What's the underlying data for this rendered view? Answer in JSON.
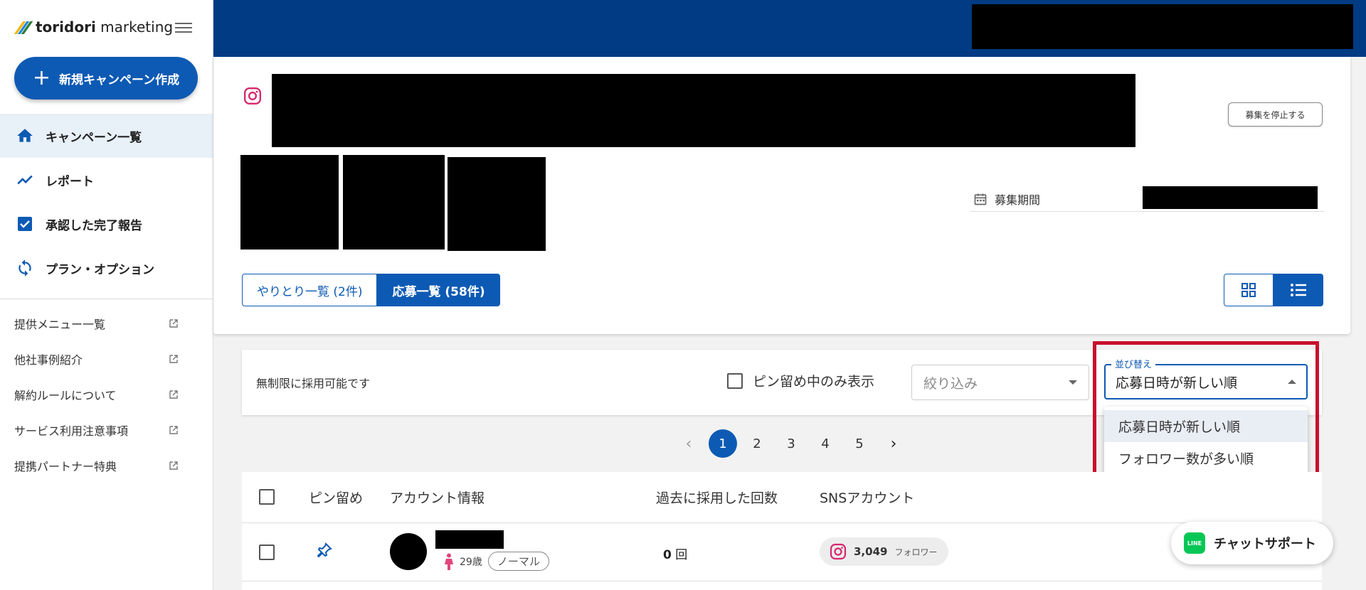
{
  "app": {
    "brand_bold": "toridori",
    "brand_rest": " marketing"
  },
  "sidebar": {
    "new_campaign_label": "新規キャンペーン作成",
    "nav": [
      {
        "label": "キャンペーン一覧",
        "icon": "home-icon"
      },
      {
        "label": "レポート",
        "icon": "trend-icon"
      },
      {
        "label": "承認した完了報告",
        "icon": "check-icon"
      },
      {
        "label": "プラン・オプション",
        "icon": "sync-icon"
      }
    ],
    "links": [
      {
        "label": "提供メニュー一覧"
      },
      {
        "label": "他社事例紹介"
      },
      {
        "label": "解約ルールについて"
      },
      {
        "label": "サービス利用注意事項"
      },
      {
        "label": "提携パートナー特典"
      }
    ]
  },
  "campaign": {
    "stop_label": "募集を停止する",
    "period_label": "募集期間",
    "tab_exchanges": "やりとり一覧 (2件)",
    "tab_applications": "応募一覧 (58件)"
  },
  "filter": {
    "unlimited_text": "無制限に採用可能です",
    "pin_only_label": "ピン留め中のみ表示",
    "narrow_placeholder": "絞り込み",
    "sort_label": "並び替え",
    "sort_value": "応募日時が新しい順",
    "sort_options": [
      "応募日時が新しい順",
      "フォロワー数が多い順"
    ]
  },
  "pagination": {
    "prev": "‹",
    "next": "›",
    "pages": [
      "1",
      "2",
      "3",
      "4",
      "5"
    ],
    "current": "1"
  },
  "table": {
    "headers": {
      "pin": "ピン留め",
      "account": "アカウント情報",
      "times": "過去に採用した回数",
      "sns": "SNSアカウント"
    },
    "rows": [
      {
        "age": "29歳",
        "rank": "ノーマル",
        "times_value": "0",
        "times_unit": "回",
        "followers": "3,049",
        "followers_label": "フォロワー"
      }
    ]
  },
  "chat": {
    "label": "チャットサポート",
    "line_text": "LINE"
  },
  "colors": {
    "primary": "#0d5ab4",
    "header": "#003b83",
    "highlight": "#c8102e",
    "instagram": "#d6296f",
    "line": "#06c755"
  }
}
